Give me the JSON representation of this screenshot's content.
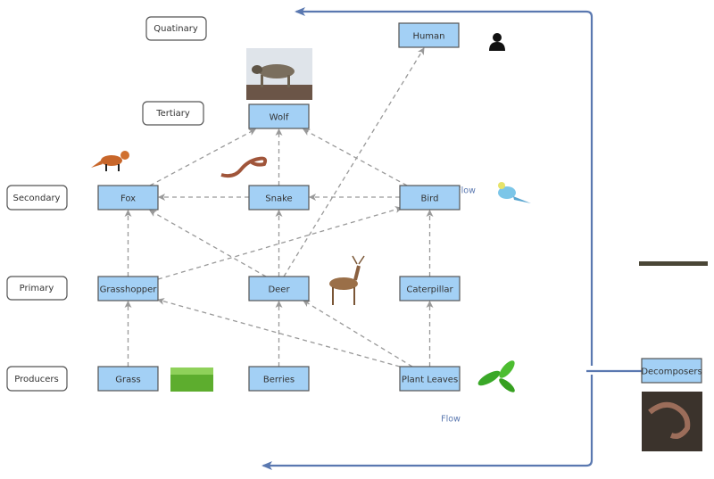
{
  "levels": {
    "quatinary": "Quatinary",
    "tertiary": "Tertiary",
    "secondary": "Secondary",
    "primary": "Primary",
    "producers": "Producers"
  },
  "nodes": {
    "human": "Human",
    "wolf": "Wolf",
    "fox": "Fox",
    "snake": "Snake",
    "bird": "Bird",
    "grasshopper": "Grasshopper",
    "deer": "Deer",
    "caterpillar": "Caterpillar",
    "grass": "Grass",
    "berries": "Berries",
    "plant_leaves": "Plant Leaves",
    "decomposers": "Decomposers"
  },
  "flow_labels": [
    "Flow",
    "Flow"
  ],
  "edges": [
    [
      "grass",
      "grasshopper"
    ],
    [
      "berries",
      "deer"
    ],
    [
      "plant_leaves",
      "caterpillar"
    ],
    [
      "plant_leaves",
      "grasshopper"
    ],
    [
      "plant_leaves",
      "deer"
    ],
    [
      "grasshopper",
      "fox"
    ],
    [
      "grasshopper",
      "bird"
    ],
    [
      "deer",
      "fox"
    ],
    [
      "deer",
      "snake"
    ],
    [
      "deer",
      "human"
    ],
    [
      "caterpillar",
      "bird"
    ],
    [
      "snake",
      "fox"
    ],
    [
      "bird",
      "snake"
    ],
    [
      "fox",
      "wolf"
    ],
    [
      "snake",
      "wolf"
    ],
    [
      "bird",
      "wolf"
    ]
  ],
  "colors": {
    "node_fill": "#a3d0f5",
    "flow_line": "#5a78b0",
    "edge": "#999999"
  }
}
